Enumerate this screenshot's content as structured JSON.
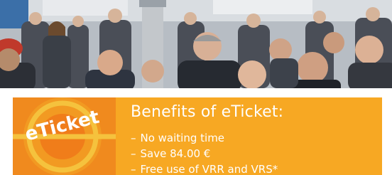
{
  "banner": {
    "logo_text": "eTicket",
    "title": "Benefits of eTicket:",
    "benefits": [
      {
        "dash": "–",
        "text": "No waiting time"
      },
      {
        "dash": "–",
        "text": "Save 84.00 €"
      },
      {
        "dash": "–",
        "text": "Free use of VRR and VRS*"
      }
    ]
  },
  "colors": {
    "banner_bg": "#f7a823",
    "logo_tile_bg": "#f08a1e",
    "logo_ring": "#f5c23d",
    "text": "#ffffff"
  },
  "icons": {
    "logo": "eticket-logo-icon",
    "photo": "crowd-photo"
  }
}
